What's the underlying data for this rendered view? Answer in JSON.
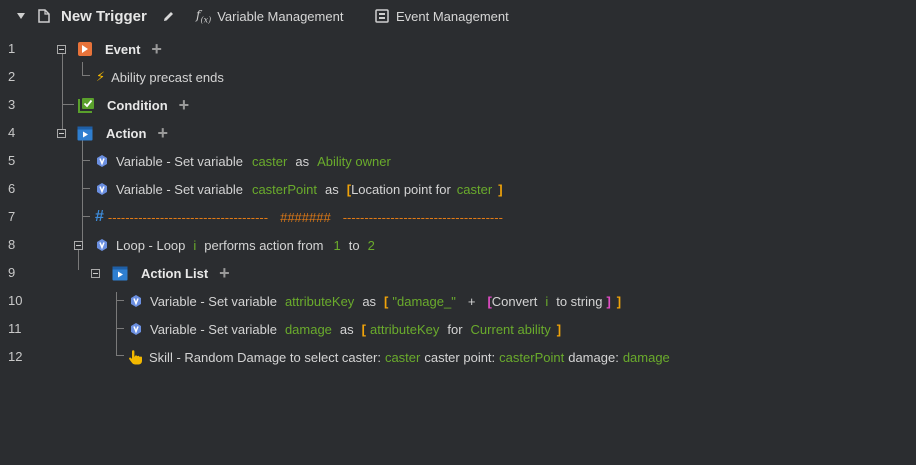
{
  "toolbar": {
    "title": "New Trigger",
    "variable_management": "Variable Management",
    "event_management": "Event Management"
  },
  "lines": [
    {
      "num": "1",
      "label": "Event"
    },
    {
      "num": "2",
      "text": "Ability precast ends"
    },
    {
      "num": "3",
      "label": "Condition"
    },
    {
      "num": "4",
      "label": "Action"
    },
    {
      "num": "5",
      "prefix": "Variable - Set variable",
      "var": "caster",
      "as": "as",
      "value": "Ability owner"
    },
    {
      "num": "6",
      "prefix": "Variable - Set variable",
      "var": "casterPoint",
      "as": "as",
      "open": "[",
      "func": "Location point for",
      "arg": "caster",
      "close": "]"
    },
    {
      "num": "7",
      "dashes_left": "-------------------------------------",
      "hashes": "#######",
      "dashes_right": "-------------------------------------"
    },
    {
      "num": "8",
      "prefix": "Loop - Loop",
      "var": "i",
      "mid": "performs action from",
      "from": "1",
      "to_word": "to",
      "to": "2"
    },
    {
      "num": "9",
      "label": "Action List"
    },
    {
      "num": "10",
      "prefix": "Variable - Set variable",
      "var": "attributeKey",
      "as": "as",
      "open": "[",
      "str": "\"damage_\"",
      "plus": "+",
      "open2": "[",
      "func": "Convert",
      "arg": "i",
      "func2": "to string",
      "close2": "]",
      "close": "]"
    },
    {
      "num": "11",
      "prefix": "Variable - Set variable",
      "var": "damage",
      "as": "as",
      "open": "[",
      "arg": "attributeKey",
      "for": "for",
      "value": "Current ability",
      "close": "]"
    },
    {
      "num": "12",
      "prefix": "Skill - Random Damage to select caster:",
      "v1": "caster",
      "t2": "caster point:",
      "v2": "casterPoint",
      "t3": "damage:",
      "v3": "damage"
    }
  ],
  "colors": {
    "background": "#2b2d30",
    "variable_green": "#6aab2c",
    "bracket_orange": "#f0a30a",
    "bracket_magenta": "#e04cc4",
    "comment_orange": "#e07a16"
  },
  "icons": [
    "collapse-arrow-icon",
    "document-icon",
    "edit-icon",
    "function-icon",
    "event-management-icon",
    "event-icon",
    "lightning-icon",
    "condition-icon",
    "action-icon",
    "variable-icon",
    "comment-hash-icon",
    "loop-icon",
    "action-list-icon",
    "skill-hand-icon",
    "add-icon"
  ]
}
